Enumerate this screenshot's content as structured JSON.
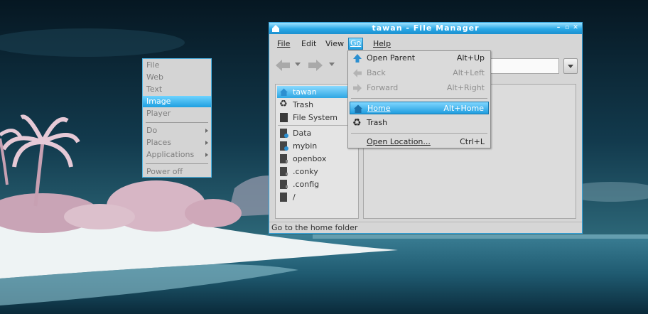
{
  "root_menu": {
    "items": [
      "File",
      "Web",
      "Text",
      "Image",
      "Player"
    ],
    "selected": "Image",
    "submenus": [
      "Do",
      "Places",
      "Applications"
    ],
    "power_off": "Power off"
  },
  "window": {
    "title": "tawan - File Manager",
    "menubar": [
      "File",
      "Edit",
      "View",
      "Go",
      "Help"
    ],
    "active_menu": "Go",
    "status": "Go to the home folder"
  },
  "side_pane": {
    "places": [
      {
        "label": "tawan",
        "icon": "home-icon",
        "selected": true
      },
      {
        "label": "Trash",
        "icon": "trash-icon"
      },
      {
        "label": "File System",
        "icon": "drive-icon"
      }
    ],
    "bookmarks": [
      {
        "label": "Data",
        "icon": "folder-icon"
      },
      {
        "label": "mybin",
        "icon": "folder-icon"
      },
      {
        "label": "openbox",
        "icon": "folder-icon"
      },
      {
        "label": ".conky",
        "icon": "folder-icon"
      },
      {
        "label": ".config",
        "icon": "folder-icon"
      },
      {
        "label": "/",
        "icon": "folder-icon"
      }
    ]
  },
  "go_menu": {
    "items": [
      {
        "label": "Open Parent",
        "accel": "Alt+Up",
        "icon": "up-arrow-icon",
        "enabled": true
      },
      {
        "label": "Back",
        "accel": "Alt+Left",
        "icon": "back-arrow-icon",
        "enabled": false
      },
      {
        "label": "Forward",
        "accel": "Alt+Right",
        "icon": "forward-arrow-icon",
        "enabled": false
      },
      {
        "label": "Home",
        "accel": "Alt+Home",
        "icon": "home-icon",
        "enabled": true,
        "highlighted": true
      },
      {
        "label": "Trash",
        "accel": "",
        "icon": "trash-icon",
        "enabled": true
      },
      {
        "label": "Open Location...",
        "accel": "Ctrl+L",
        "icon": "",
        "enabled": true
      }
    ]
  },
  "colors": {
    "accent": "#2aa8e6",
    "menu_bg": "#d4d4d4",
    "disabled_text": "#8f8f8f"
  }
}
